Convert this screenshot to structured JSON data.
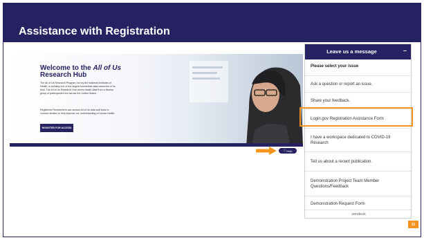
{
  "slide": {
    "title": "Assistance with Registration",
    "page_number": "31"
  },
  "hub": {
    "title_prefix": "Welcome to the",
    "title_em": "All of Us",
    "title_suffix": "Research Hub",
    "para1": "The All of Us Research Program, led by the National Institutes of Health, is building one of the largest biomedical data resources of its kind. The All of Us Research Hub stores health data from a diverse group of participants from across the United States.",
    "para2": "Registered Researchers can access All of Us data and tools to conduct studies to help improve our understanding of human health.",
    "register_button": "REGISTER FOR ACCESS",
    "help_label": "Help",
    "help_icon": "question-circle-icon",
    "arrow_icon": "orange-right-arrow-icon"
  },
  "widget": {
    "header": "Leave us a message",
    "minimize": "–",
    "subtitle": "Please select your issue",
    "options": [
      "Ask a question or report an issue.",
      "Share your feedback.",
      "Login.gov Registration Assistance Form",
      "I have a workspace dedicated to COVID-19 Research",
      "Tell us about a recent publication.",
      "Demonstration Project Team Member Questions/Feedback",
      "Demonstration Request Form"
    ],
    "highlighted_option_index": 2,
    "footer": "zendesk"
  },
  "colors": {
    "navy": "#262262",
    "orange": "#f7941d"
  }
}
